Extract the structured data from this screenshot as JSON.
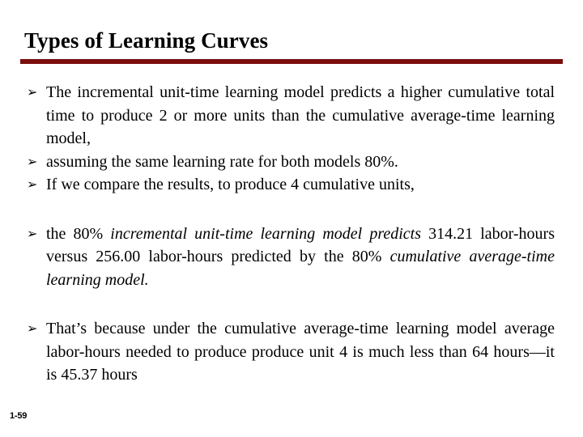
{
  "slide": {
    "title": "Types of Learning Curves",
    "rule_color": "#7B0D0D",
    "background_color": "#FFFFFF",
    "text_color": "#000000",
    "footer": "1-59",
    "bullet_glyph": "➢",
    "bullets": [
      {
        "id": "incremental-unit-time-higher",
        "text": "The incremental unit-time learning model predicts a higher cumulative total time to produce 2 or more units than the cumulative average-time learning model,",
        "justified": true,
        "gap_before": false
      },
      {
        "id": "same-learning-rate",
        "text": "assuming the same learning rate for both models 80%.",
        "justified": false,
        "gap_before": false
      },
      {
        "id": "compare-results-4-units",
        "text": "If we compare the results, to produce 4 cumulative units,",
        "justified": false,
        "gap_before": false
      },
      {
        "id": "predicted-labor-hours",
        "justified": true,
        "gap_before": true,
        "runs": [
          {
            "text": "the 80% ",
            "style": "regular"
          },
          {
            "text": "incremental unit-time learning model predicts",
            "style": "italic"
          },
          {
            "text": " 314.21 labor-hours versus 256.00 labor-hours predicted by the 80% ",
            "style": "regular"
          },
          {
            "text": "cumulative average-time learning model.",
            "style": "italic"
          }
        ]
      },
      {
        "id": "thats-because-unit-4",
        "text": "That’s because under the cumulative average-time learning model average labor-hours needed to produce produce unit 4 is much less than 64 hours—it is 45.37 hours",
        "justified": true,
        "gap_before": true
      }
    ]
  }
}
